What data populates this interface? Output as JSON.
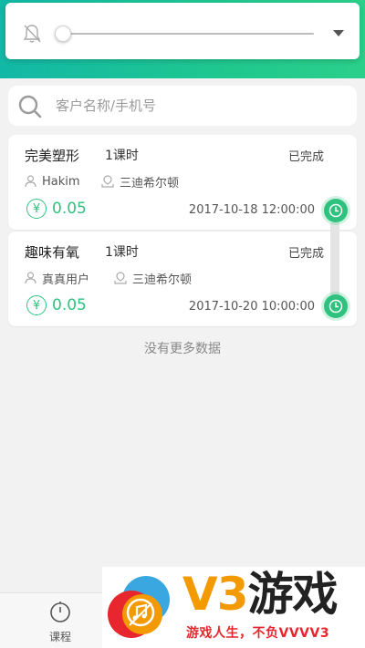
{
  "header": {
    "brightness_level": 0.0,
    "accent_color": "#1fc78f"
  },
  "search": {
    "placeholder": "客户名称/手机号",
    "value": ""
  },
  "courses": [
    {
      "title": "完美塑形",
      "hours": "1课时",
      "status": "已完成",
      "member": "Hakim",
      "location": "三迪希尔顿",
      "price": "0.05",
      "datetime": "2017-10-18 12:00:00"
    },
    {
      "title": "趣味有氧",
      "hours": "1课时",
      "status": "已完成",
      "member": "真真用户",
      "location": "三迪希尔顿",
      "price": "0.05",
      "datetime": "2017-10-20 10:00:00"
    }
  ],
  "currency_symbol": "¥",
  "list_footer": "没有更多数据",
  "bottom_nav": {
    "course_label": "课程"
  },
  "watermark": {
    "brand": "V3",
    "brand_cn": "游戏",
    "slogan": "游戏人生，不负VVVV3"
  }
}
